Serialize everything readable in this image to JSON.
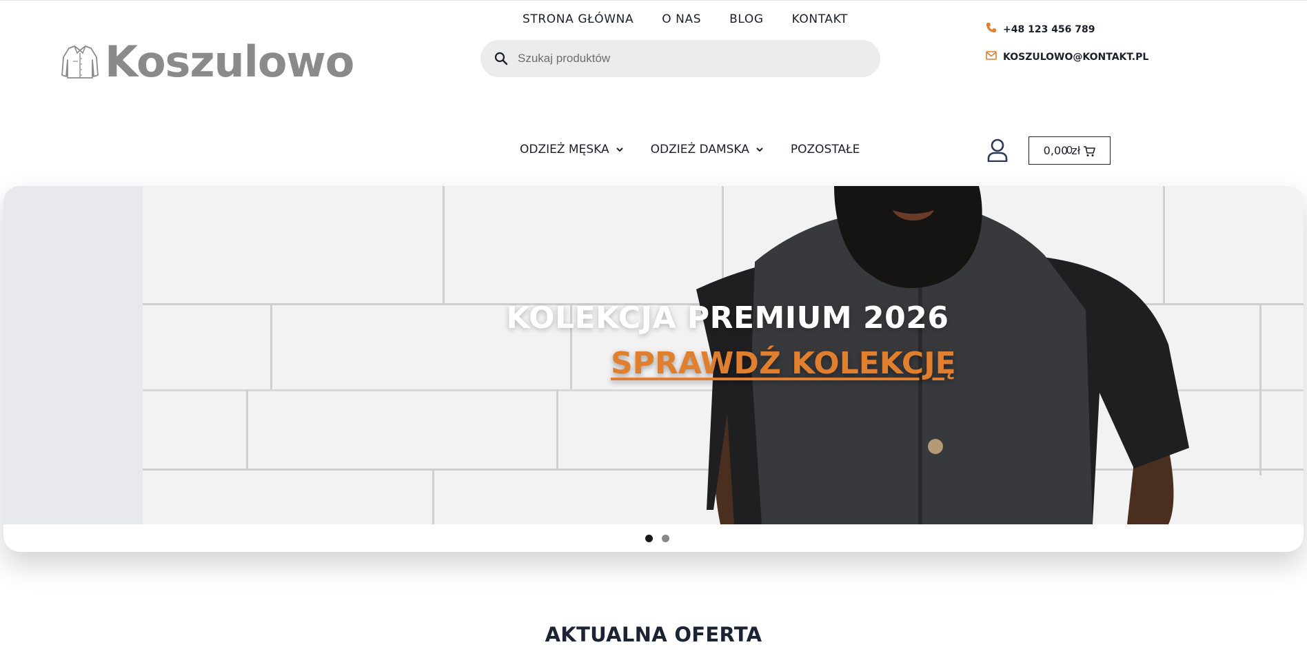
{
  "brand": {
    "logo_text": "Koszulowo"
  },
  "top_nav": [
    "STRONA GŁÓWNA",
    "O NAS",
    "BLOG",
    "KONTAKT"
  ],
  "search": {
    "placeholder": "Szukaj produktów",
    "value": ""
  },
  "contact": {
    "phone": "+48 123 456 789",
    "email": "KOSZULOWO@KONTAKT.PL"
  },
  "main_nav": [
    {
      "label": "ODZIEŻ MĘSKA",
      "has_dropdown": true
    },
    {
      "label": "ODZIEŻ DAMSKA",
      "has_dropdown": true
    },
    {
      "label": "POZOSTAŁE",
      "has_dropdown": false
    }
  ],
  "cart": {
    "amount": "0,00 zł",
    "count": "0"
  },
  "hero": {
    "title": "KOLEKCJA PREMIUM 2026",
    "cta": "SPRAWDŹ KOLEKCJĘ",
    "slides": 2,
    "active_slide": 1
  },
  "section": {
    "title": "AKTUALNA OFERTA"
  },
  "colors": {
    "accent": "#e07f2e",
    "text_dark": "#1a1f2b",
    "search_bg": "#ececec",
    "logo_gray": "#8a8a8a"
  },
  "icons": [
    "shirt-logo-icon",
    "search-icon",
    "phone-icon",
    "mail-icon",
    "chevron-down-icon",
    "user-icon",
    "cart-icon"
  ]
}
